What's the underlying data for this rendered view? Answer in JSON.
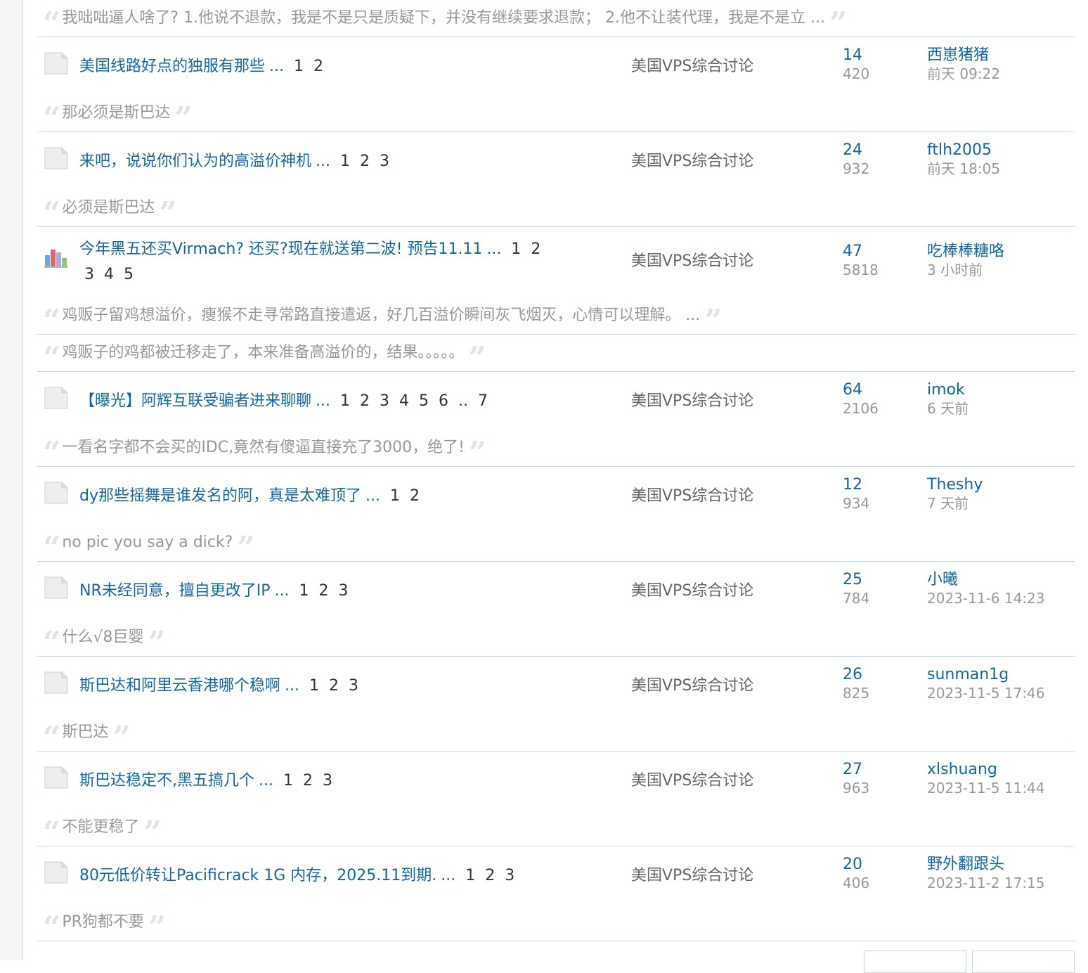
{
  "top_quote": "我咄咄逼人啥了? 1.他说不退款，我是不是只是质疑下，并没有继续要求退款； 2.他不让装代理，我是不是立 ...",
  "threads": [
    {
      "title": "美国线路好点的独服有那些",
      "ellipsis": "...",
      "pages": [
        "1",
        "2"
      ],
      "forum": "美国VPS综合讨论",
      "replies": "14",
      "views": "420",
      "last_user": "西崽猪猪",
      "last_time": "前天 09:22",
      "quote": "那必须是斯巴达",
      "icon": "folder-icon"
    },
    {
      "title": "来吧，说说你们认为的高溢价神机",
      "ellipsis": "...",
      "pages": [
        "1",
        "2",
        "3"
      ],
      "forum": "美国VPS综合讨论",
      "replies": "24",
      "views": "932",
      "last_user": "ftlh2005",
      "last_time": "前天 18:05",
      "quote": "必须是斯巴达",
      "icon": "folder-icon"
    },
    {
      "title": "今年黑五还买Virmach? 还买?现在就送第二波! 预告11.11",
      "ellipsis": "...",
      "pages": [
        "1",
        "2",
        "3",
        "4",
        "5"
      ],
      "forum": "美国VPS综合讨论",
      "replies": "47",
      "views": "5818",
      "last_user": "吃棒棒糖咯",
      "last_time": "3 小时前",
      "quote": "鸡贩子留鸡想溢价，瘦猴不走寻常路直接遣返，好几百溢价瞬间灰飞烟灭，心情可以理解。 ...",
      "quote2": "鸡贩子的鸡都被迁移走了，本来准备高溢价的，结果。。。。。",
      "icon": "poll-icon"
    },
    {
      "title": "【曝光】阿辉互联受骗者进来聊聊",
      "ellipsis": "...",
      "pages": [
        "1",
        "2",
        "3",
        "4",
        "5",
        "6",
        "..",
        "7"
      ],
      "forum": "美国VPS综合讨论",
      "replies": "64",
      "views": "2106",
      "last_user": "imok",
      "last_time": "6 天前",
      "quote": "一看名字都不会买的IDC,竟然有傻逼直接充了3000，绝了!",
      "icon": "folder-icon"
    },
    {
      "title": "dy那些摇舞是谁发名的阿，真是太难顶了",
      "ellipsis": "...",
      "pages": [
        "1",
        "2"
      ],
      "forum": "美国VPS综合讨论",
      "replies": "12",
      "views": "934",
      "last_user": "Theshy",
      "last_time": "7 天前",
      "quote": "no pic you say a dick?",
      "icon": "folder-icon"
    },
    {
      "title": "NR未经同意，擅自更改了IP",
      "ellipsis": "...",
      "pages": [
        "1",
        "2",
        "3"
      ],
      "forum": "美国VPS综合讨论",
      "replies": "25",
      "views": "784",
      "last_user": "小曦",
      "last_time": "2023-11-6 14:23",
      "quote": "什么√8巨婴",
      "icon": "folder-icon"
    },
    {
      "title": "斯巴达和阿里云香港哪个稳啊",
      "ellipsis": "...",
      "pages": [
        "1",
        "2",
        "3"
      ],
      "forum": "美国VPS综合讨论",
      "replies": "26",
      "views": "825",
      "last_user": "sunman1g",
      "last_time": "2023-11-5 17:46",
      "quote": "斯巴达",
      "icon": "folder-icon"
    },
    {
      "title": "斯巴达稳定不,黑五搞几个",
      "ellipsis": "...",
      "pages": [
        "1",
        "2",
        "3"
      ],
      "forum": "美国VPS综合讨论",
      "replies": "27",
      "views": "963",
      "last_user": "xlshuang",
      "last_time": "2023-11-5 11:44",
      "quote": "不能更稳了",
      "icon": "folder-icon"
    },
    {
      "title": "80元低价转让Pacificrack 1G 内存，2025.11到期.",
      "ellipsis": "...",
      "pages": [
        "1",
        "2",
        "3"
      ],
      "forum": "美国VPS综合讨论",
      "replies": "20",
      "views": "406",
      "last_user": "野外翻跟头",
      "last_time": "2023-11-2 17:15",
      "quote": "PR狗都不要",
      "icon": "folder-icon"
    }
  ],
  "colors": {
    "link": "#13689f",
    "muted": "#999999",
    "forum": "#666666",
    "divider": "#c2d5e3"
  }
}
